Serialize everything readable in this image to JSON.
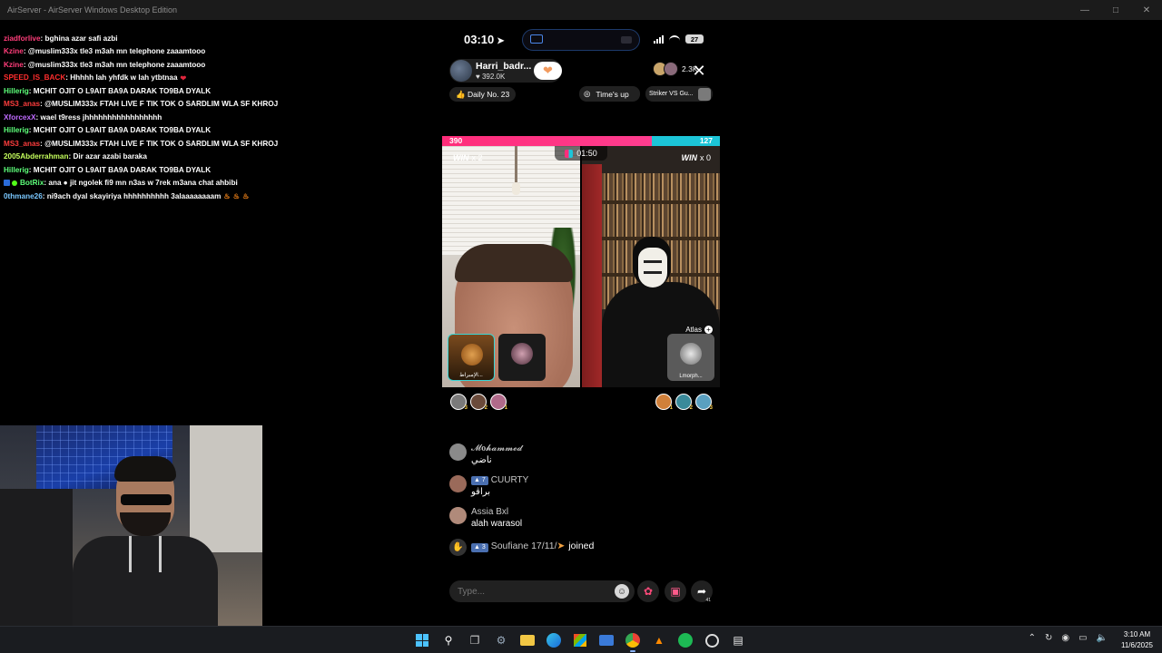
{
  "window": {
    "title": "AirServer - AirServer Windows Desktop Edition"
  },
  "stream_chat": [
    {
      "user": "ziadforlive",
      "user_color": "#ff3d7a",
      "text": " : bghina azar safi azbi"
    },
    {
      "user": "Kzine",
      "user_color": "#ff3d7a",
      "text": " : @muslim333x tle3 m3ah mn telephone zaaamtooo"
    },
    {
      "user": "Kzine",
      "user_color": "#ff3d7a",
      "text": " : @muslim333x tle3 m3ah mn telephone zaaamtooo"
    },
    {
      "user": "SPEED_IS_BACK",
      "user_color": "#ff2d2d",
      "text": " : Hhhhh lah yhfdk w lah ytbtnaa",
      "suffix": "heart"
    },
    {
      "user": "Hillerig",
      "user_color": "#5dff7a",
      "text": " : MCHIT OJIT O L9AIT BA9A DARAK TO9BA DYALK"
    },
    {
      "user": "MS3_anas",
      "user_color": "#ff3d3d",
      "text": " : @MUSLIM333x FTAH LIVE F TIK TOK O SARDLIM WLA SF KHROJ"
    },
    {
      "user": "XforcexX",
      "user_color": "#c06bff",
      "text": " : wael t9ress jhhhhhhhhhhhhhhhhh"
    },
    {
      "user": "Hillerig",
      "user_color": "#5dff7a",
      "text": " : MCHIT OJIT O L9AIT BA9A DARAK TO9BA DYALK"
    },
    {
      "user": "MS3_anas",
      "user_color": "#ff3d3d",
      "text": " : @MUSLIM333x FTAH LIVE F TIK TOK O SARDLIM WLA SF KHROJ"
    },
    {
      "user": "2005Abderrahman",
      "user_color": "#c6ff5d",
      "text": " : Dir azar azabi baraka"
    },
    {
      "user": "Hillerig",
      "user_color": "#5dff7a",
      "text": " : MCHIT OJIT O L9AIT BA9A DARAK TO9BA DYALK"
    },
    {
      "user": "BotRix",
      "user_color": "#5dff7a",
      "text": " : ana  ●  jit ngolek fi9 mn n3as w 7rek m3ana chat ahbibi",
      "prefix": "badges"
    },
    {
      "user": "0thmane26",
      "user_color": "#7ac8ff",
      "text": " : ni9ach dyal skayiriya hhhhhhhhhh 3alaaaaaaaam",
      "suffix": "fire"
    }
  ],
  "phone": {
    "status": {
      "time": "03:10",
      "battery": "27"
    },
    "host": {
      "name": "Harri_badr...",
      "likes": "392.0K"
    },
    "viewer_count": "2.3K",
    "daily_label": "Daily No. 23",
    "times_up_label": "Time's up",
    "striker_label": "Striker VS Gu...",
    "battle": {
      "score_left": 390,
      "score_right": 127,
      "timer": "01:50",
      "win_label": "WIN",
      "win_left": "x 2",
      "win_right": "x 0",
      "atlas_label": "Atlas",
      "guest_left_name": "الإمبراط...",
      "guest_right_name": "Lmorph..."
    },
    "fan_ranks_left": [
      "3",
      "2",
      "1"
    ],
    "fan_ranks_right": [
      "1",
      "2",
      "3"
    ],
    "comments": [
      {
        "name": "𝓜𝐨𝓱𝓪𝓶𝓶𝓮𝓭",
        "text": "ناضي",
        "level": ""
      },
      {
        "name": "CUURTY",
        "text": "براڤو",
        "level": "7"
      },
      {
        "name": "Assia Bxl",
        "text": "alah  warasol",
        "level": ""
      }
    ],
    "joined": {
      "level": "3",
      "name": "Soufiane 17/11/",
      "text": "joined"
    },
    "input_placeholder": "Type...",
    "share_count": "41"
  },
  "taskbar": {
    "time": "3:10 AM",
    "date": "11/6/2025"
  }
}
